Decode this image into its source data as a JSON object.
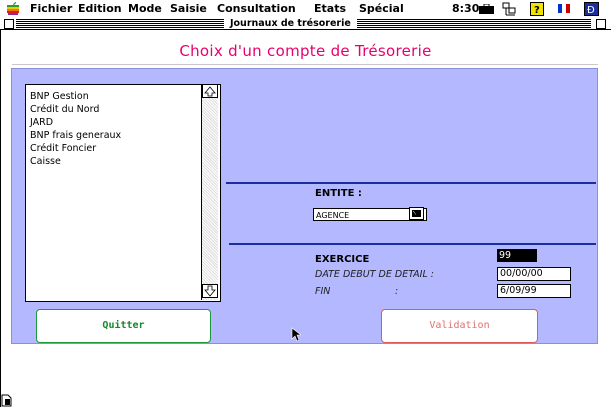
{
  "menubar": {
    "items": [
      "Fichier",
      "Edition",
      "Mode",
      "Saisie",
      "Consultation",
      "Etats",
      "Spécial"
    ],
    "clock": "8:30",
    "flag_colors": [
      "#0033cc",
      "#ffffff",
      "#cc0000"
    ]
  },
  "window": {
    "title": "Journaux de trésorerie"
  },
  "header": {
    "title": "Choix d'un compte de Trésorerie",
    "color": "#e8006e"
  },
  "accounts": {
    "items": [
      "BNP Gestion",
      "Crédit du Nord",
      "JARD",
      "BNP frais generaux",
      "Crédit Foncier",
      "Caisse"
    ]
  },
  "entite": {
    "label": "ENTITE :",
    "selected": "AGENCE"
  },
  "exercice": {
    "label": "EXERCICE",
    "value": "99",
    "date_debut_label": "DATE DEBUT DE DETAIL :",
    "date_debut_value": "00/00/00",
    "fin_label": "FIN",
    "fin_sep": ":",
    "fin_value": "6/09/99"
  },
  "buttons": {
    "quit": "Quitter",
    "validate": "Validation"
  },
  "colors": {
    "panel": "#b3b8ff",
    "divider": "#1a2e9e",
    "quit_border": "#1a9a3c",
    "validate_border": "#e05a5a"
  }
}
